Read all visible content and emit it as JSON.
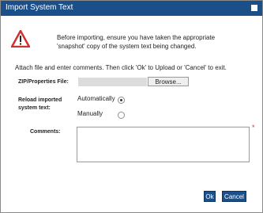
{
  "dialog": {
    "title": "Import System Text",
    "close_icon": "close-icon",
    "warning_icon": "warning-triangle-icon",
    "warning_line1": "Before importing, ensure you have taken the appropriate",
    "warning_line2": "'snapshot' copy of the system text being changed.",
    "instructions": "Attach file and enter comments. Then click 'Ok' to Upload or 'Cancel' to exit."
  },
  "form": {
    "file_label": "ZIP/Properties File:",
    "file_value": "",
    "browse_label": "Browse...",
    "reload_label_line1": "Reload imported",
    "reload_label_line2": "system text:",
    "option_auto": "Automatically",
    "option_manual": "Manually",
    "selected_option": "Automatically",
    "comments_label": "Comments:",
    "comments_value": "",
    "required_marker": "*"
  },
  "buttons": {
    "ok": "Ok",
    "cancel": "Cancel"
  },
  "colors": {
    "titlebar": "#1b4f8a",
    "button": "#1b4f8a",
    "warning_red": "#d03030"
  }
}
